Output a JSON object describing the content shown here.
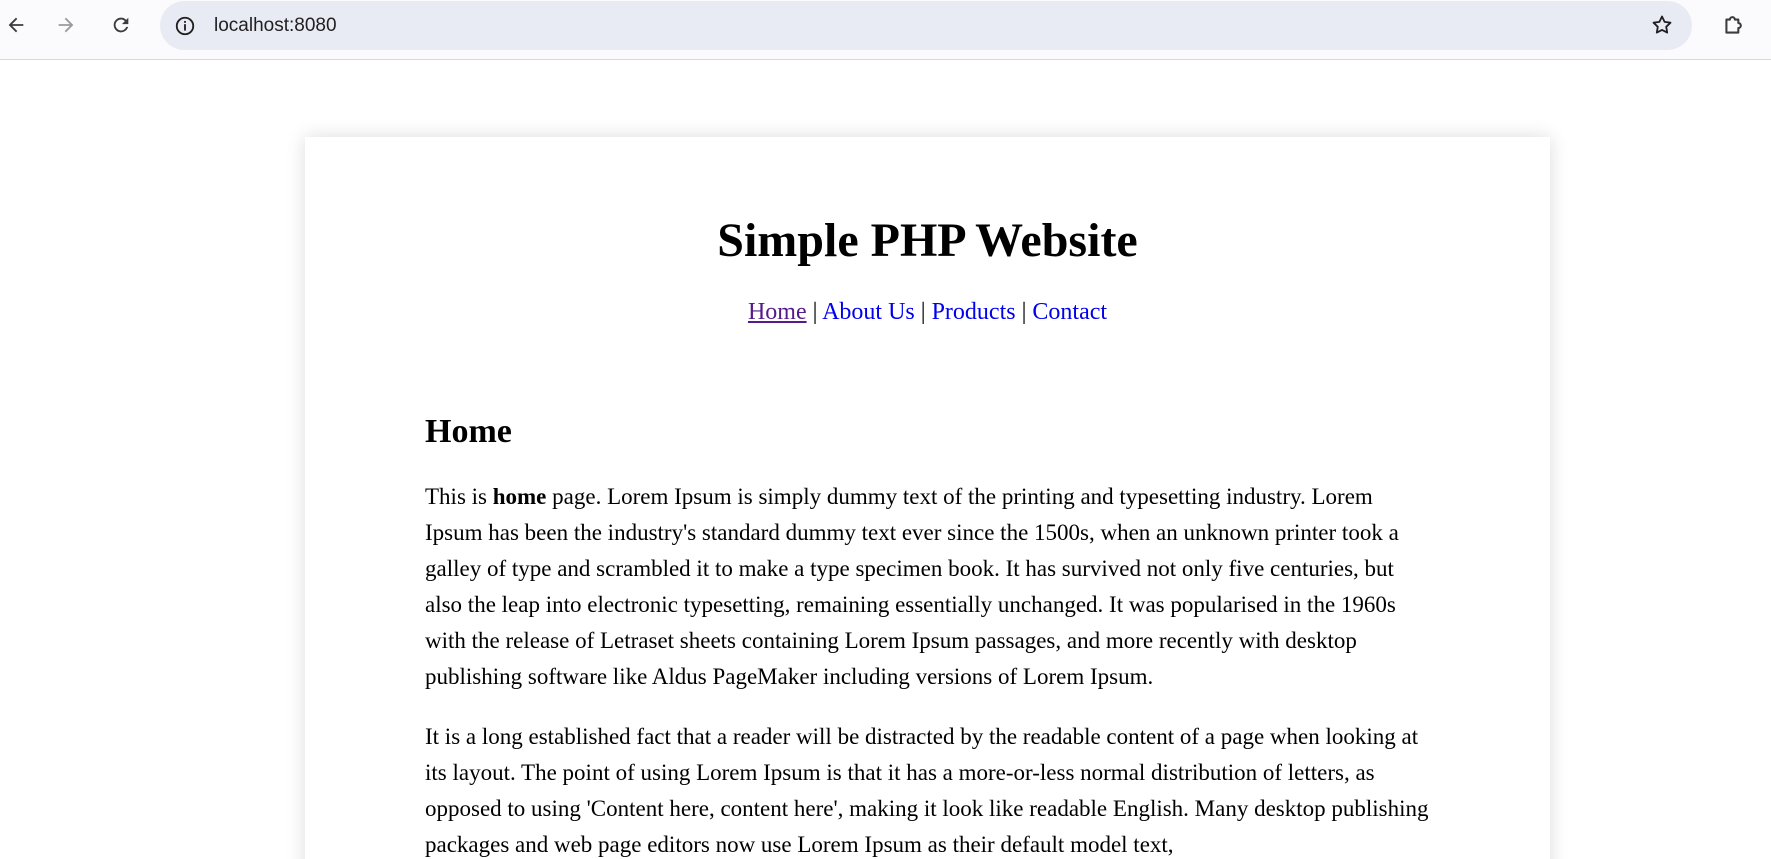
{
  "browser": {
    "url": "localhost:8080"
  },
  "site": {
    "title": "Simple PHP Website",
    "nav": [
      {
        "label": "Home"
      },
      {
        "label": "About Us"
      },
      {
        "label": "Products"
      },
      {
        "label": "Contact"
      }
    ],
    "separator": "|"
  },
  "page": {
    "heading": "Home",
    "p1_before": "This is ",
    "p1_bold": "home",
    "p1_after": " page. Lorem Ipsum is simply dummy text of the printing and typesetting industry. Lorem Ipsum has been the industry's standard dummy text ever since the 1500s, when an unknown printer took a galley of type and scrambled it to make a type specimen book. It has survived not only five centuries, but also the leap into electronic typesetting, remaining essentially unchanged. It was popularised in the 1960s with the release of Letraset sheets containing Lorem Ipsum passages, and more recently with desktop publishing software like Aldus PageMaker including versions of Lorem Ipsum.",
    "p2": "It is a long established fact that a reader will be distracted by the readable content of a page when looking at its layout. The point of using Lorem Ipsum is that it has a more-or-less normal distribution of letters, as opposed to using 'Content here, content here', making it look like readable English. Many desktop publishing packages and web page editors now use Lorem Ipsum as their default model text,"
  },
  "icons": {
    "back": "back-arrow-icon",
    "forward": "forward-arrow-icon",
    "reload": "reload-icon",
    "site_info": "info-icon",
    "bookmark": "star-icon",
    "extensions": "puzzle-icon"
  }
}
